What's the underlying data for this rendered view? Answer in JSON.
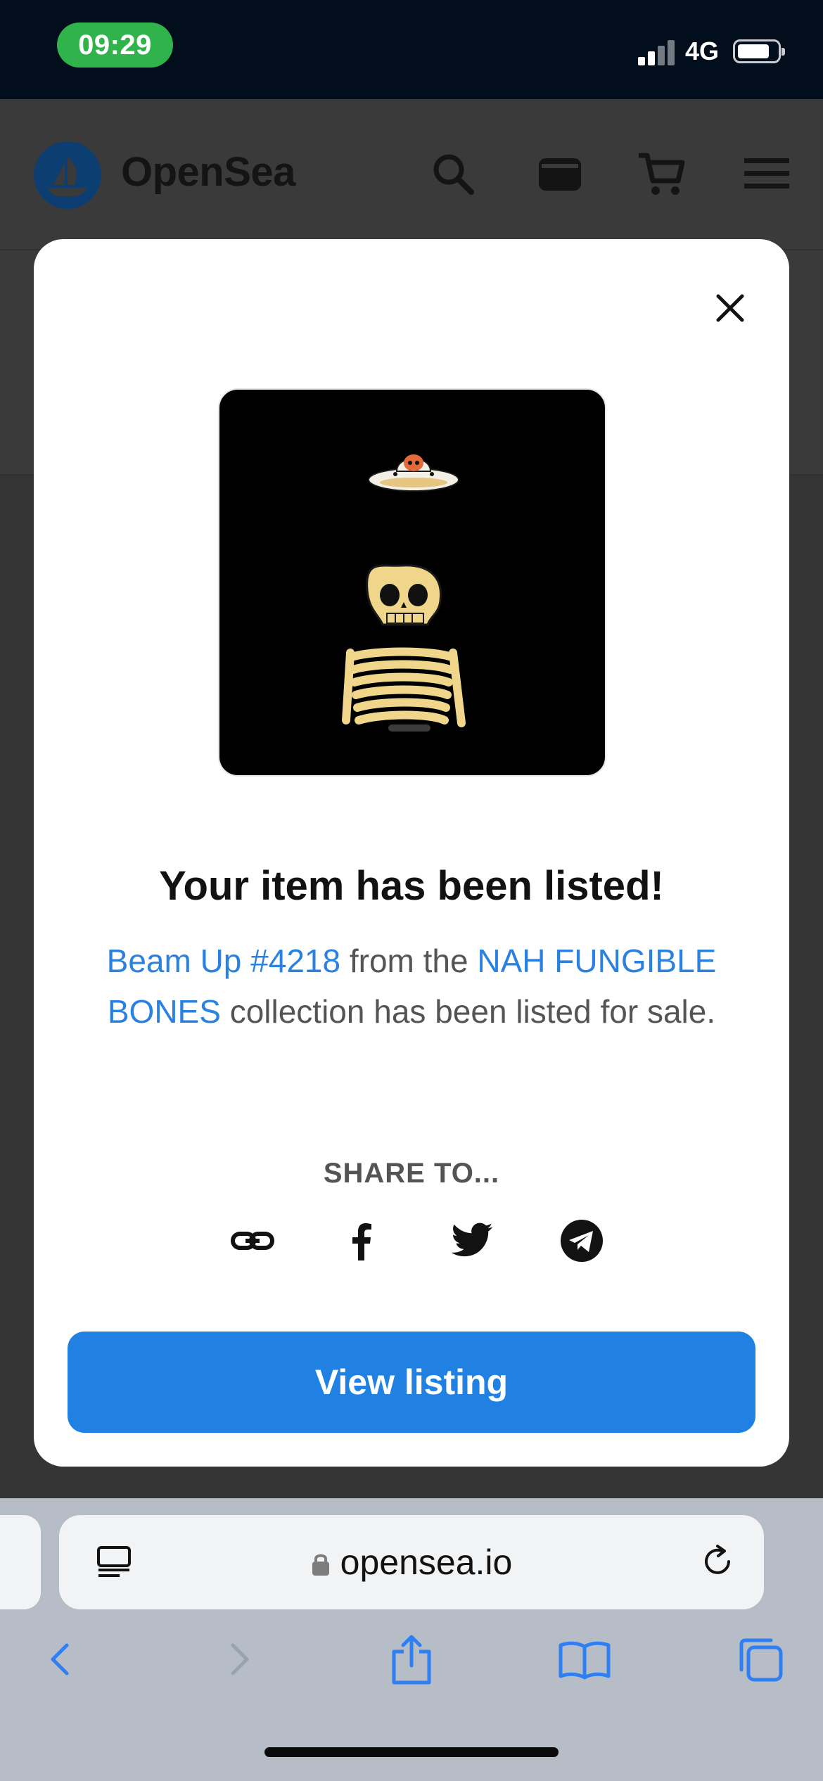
{
  "status_bar": {
    "time": "09:29",
    "network": "4G"
  },
  "site": {
    "brand": "OpenSea"
  },
  "modal": {
    "nft_image_alt": "Beam Up #4218",
    "headline": "Your item has been listed!",
    "description": {
      "item_name": "Beam Up #4218",
      "text_from": " from the ",
      "collection_name": "NAH FUNGIBLE BONES",
      "text_suffix": " collection has been listed for sale."
    },
    "share_label": "SHARE TO...",
    "share_icons": [
      "link-icon",
      "facebook-icon",
      "twitter-icon",
      "telegram-icon"
    ],
    "view_button": "View listing"
  },
  "browser": {
    "url": "opensea.io"
  },
  "colors": {
    "accent": "#2081e2",
    "link": "#2a81e0",
    "status_pill": "#30b34a"
  }
}
